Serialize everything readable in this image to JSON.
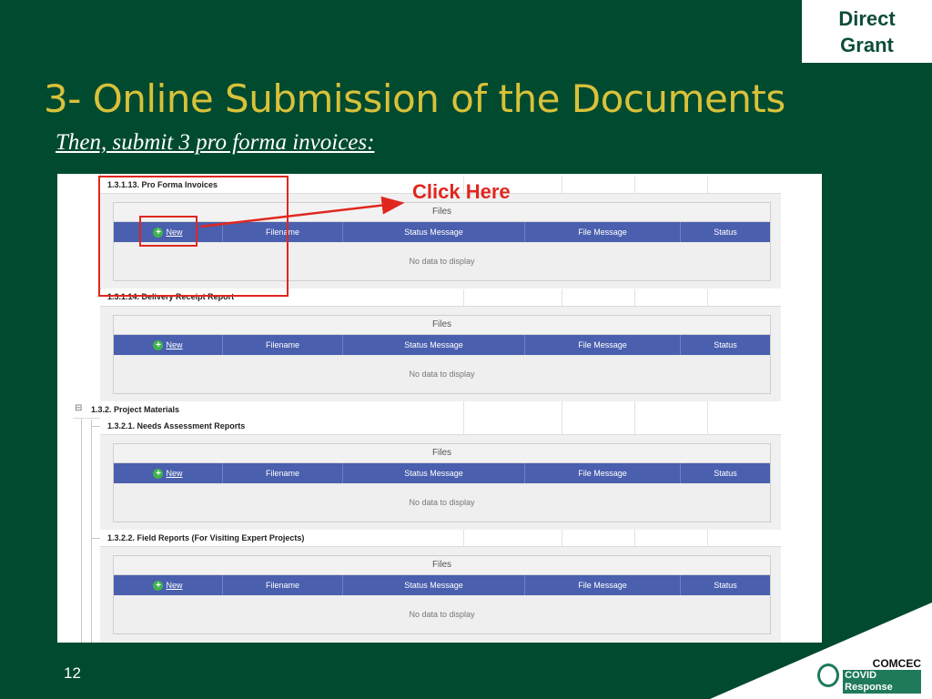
{
  "badge": {
    "line1": "Direct",
    "line2": "Grant"
  },
  "slide": {
    "title": "3- Online Submission of the Documents",
    "subtitle": "Then, submit 3 pro forma invoices:",
    "callout": "Click Here",
    "page_number": "12"
  },
  "colors": {
    "background": "#004a2f",
    "title": "#d9c13a",
    "highlight": "#e0271f",
    "table_header": "#4a5fae"
  },
  "sections": [
    {
      "label": "1.3.1.13. Pro Forma Invoices"
    },
    {
      "label": "1.3.1.14. Delivery Receipt Report"
    },
    {
      "label": "1.3.2. Project Materials"
    },
    {
      "label": "1.3.2.1. Needs Assessment Reports"
    },
    {
      "label": "1.3.2.2. Field Reports (For Visiting Expert Projects)"
    }
  ],
  "panel": {
    "title": "Files",
    "columns": [
      "New",
      "Filename",
      "Status Message",
      "File Message",
      "Status"
    ],
    "empty_text": "No data to display"
  },
  "tree": {
    "collapse_symbol": "⊟"
  },
  "logo": {
    "line1": "COMCEC",
    "line2": "COVID Response"
  }
}
